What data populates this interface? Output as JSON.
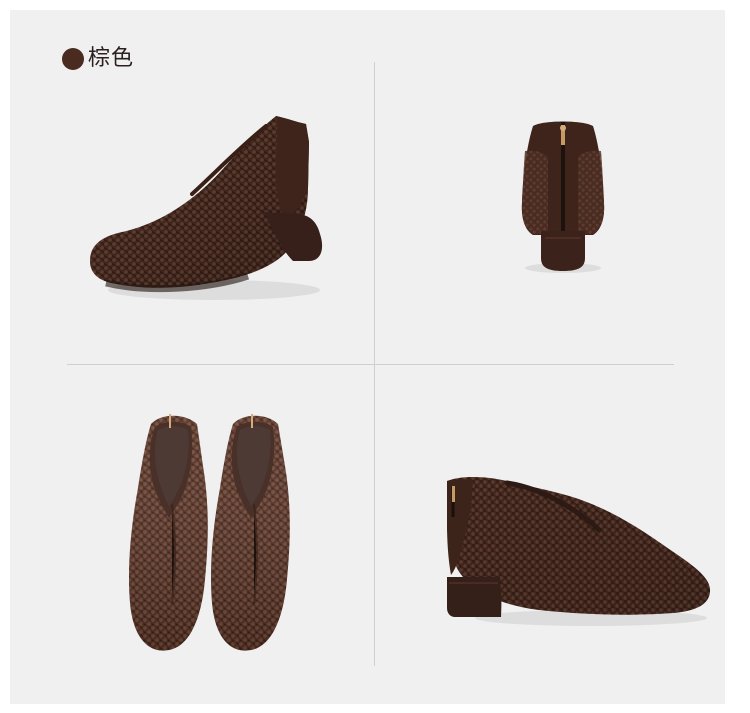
{
  "variant": {
    "color_name": "棕色",
    "swatch_color": "#4a2b20"
  },
  "images": {
    "top_left": "brown-woven-ankle-boot-side",
    "top_right": "brown-woven-ankle-boot-back-zipper",
    "bottom_left": "brown-woven-ankle-boot-pair-top",
    "bottom_right": "brown-woven-ankle-boot-side-right"
  },
  "colors": {
    "background": "#f0f0f0",
    "leather": "#4b2d23",
    "leather_dark": "#2f1b14",
    "leather_light": "#6b4738",
    "zipper": "#c59a65"
  }
}
